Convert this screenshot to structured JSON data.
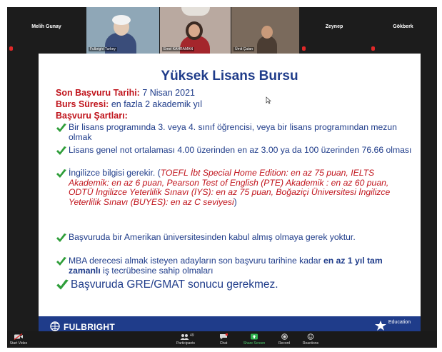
{
  "participants": [
    {
      "name": "Melih Gunay",
      "type": "name"
    },
    {
      "name": "Fulbright Turkey",
      "type": "video"
    },
    {
      "name": "Emel KAHRAMAN",
      "type": "video"
    },
    {
      "name": "Ümit Çatan",
      "type": "video"
    },
    {
      "name": "Zeynep",
      "type": "name"
    },
    {
      "name": "Gökberk",
      "type": "name"
    }
  ],
  "slide": {
    "title": "Yüksek Lisans Bursu",
    "deadline_label": "Son Başvuru Tarihi:",
    "deadline_value": "7 Nisan 2021",
    "duration_label": "Burs Süresi:",
    "duration_value": "en fazla 2 akademik yıl",
    "requirements_heading": "Başvuru Şartları:",
    "items": {
      "i1": "Bir lisans programında 3. veya 4. sınıf öğrencisi, veya bir lisans programından mezun olmak",
      "i2": "Lisans genel not ortalaması 4.00 üzerinden en az 3.00 ya da 100 üzerinden 76.66 olması",
      "i3": {
        "a": "İngilizce bilgisi gerekir. (",
        "b": "TOEFL İbt Special Home Edition",
        "c": ": en az 75 puan, ",
        "d": "IELTS Akademik",
        "e": ": en az 6 puan, ",
        "f": "Pearson Test of English (PTE) Akademik",
        "g": " : en az 60 puan, ",
        "h": "ODTÜ İngilizce Yeterlilik Sınavı (İYS)",
        "i": ": en az 75 puan, ",
        "j": "Boğaziçi Üniversitesi İngilizce Yeterlilik Sınavı (BUYES)",
        "k": ": en az C seviyesi",
        "l": ")"
      },
      "i4": "Başvuruda bir Amerikan üniversitesinden kabul almış olmaya gerek yoktur.",
      "i5": {
        "a": "MBA derecesi almak isteyen adayların son başvuru tarihine kadar ",
        "b": "en az 1 yıl tam zamanlı",
        "c": " iş tecrübesine sahip olmaları"
      },
      "i6": "Başvuruda GRE/GMAT sonucu gerekmez."
    },
    "footer_logo": "FULBRIGHT",
    "footer_right": "Education"
  },
  "toolbar": {
    "start_video": "Start Video",
    "participants": "Participants",
    "participants_count": "49",
    "chat": "Chat",
    "share_screen": "Share Screen",
    "record": "Record",
    "reactions": "Reactions"
  },
  "colors": {
    "accent_blue": "#1f3c8a",
    "accent_red": "#c0141c",
    "check_green": "#2f9e3a"
  }
}
